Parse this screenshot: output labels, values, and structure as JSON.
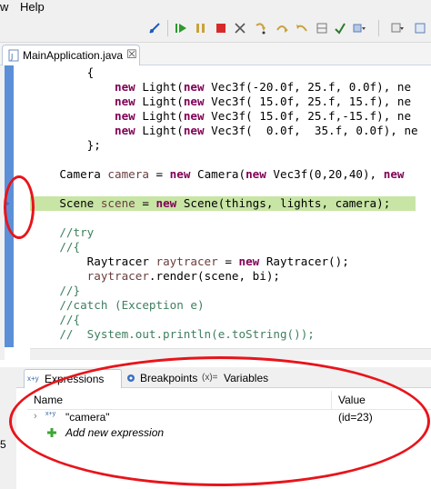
{
  "menu": {
    "items": [
      "w",
      "Help"
    ]
  },
  "editor": {
    "tab_label": "MainApplication.java",
    "tab_close": "☒",
    "lines": [
      {
        "text": "        {"
      },
      {
        "text": "            new Light(new Vec3f(-20.0f, 25.f, 0.0f), ne"
      },
      {
        "text": "            new Light(new Vec3f( 15.0f, 25.f, 15.f), ne"
      },
      {
        "text": "            new Light(new Vec3f( 15.0f, 25.f,-15.f), ne"
      },
      {
        "text": "            new Light(new Vec3f(  0.0f,  35.f, 0.0f), ne"
      },
      {
        "text": "        };"
      },
      {
        "text": ""
      },
      {
        "text": "    Camera camera = new Camera(new Vec3f(0,20,40), new"
      },
      {
        "text": ""
      },
      {
        "text": "    Scene scene = new Scene(things, lights, camera);"
      },
      {
        "text": ""
      },
      {
        "text": "    //try"
      },
      {
        "text": "    //{"
      },
      {
        "text": "        Raytracer raytracer = new Raytracer();"
      },
      {
        "text": "        raytracer.render(scene, bi);"
      },
      {
        "text": "    //}"
      },
      {
        "text": "    //catch (Exception e)"
      },
      {
        "text": "    //{"
      },
      {
        "text": "    //  System.out.println(e.toString());"
      }
    ]
  },
  "debug": {
    "tabs": [
      {
        "label": "Expressions",
        "icon": "expressions-icon"
      },
      {
        "label": "Breakpoints",
        "icon": "breakpoints-icon"
      },
      {
        "label": "Variables",
        "icon": "variables-icon"
      }
    ],
    "variables_icon_text": "(x)=",
    "expressions_icon_text": "x+y",
    "column_name": "Name",
    "column_value": "Value",
    "row": {
      "expression": "\"camera\"",
      "value": "(id=23)",
      "icon_text": "x+y"
    },
    "add_new": "Add new expression",
    "left_strip_text": "5"
  },
  "colors": {
    "highlight": "#c8e5a5",
    "ruler": "#5b8fd8",
    "annotation": "#e8141b",
    "keyword": "#7f0055",
    "comment": "#3f7f5f"
  }
}
